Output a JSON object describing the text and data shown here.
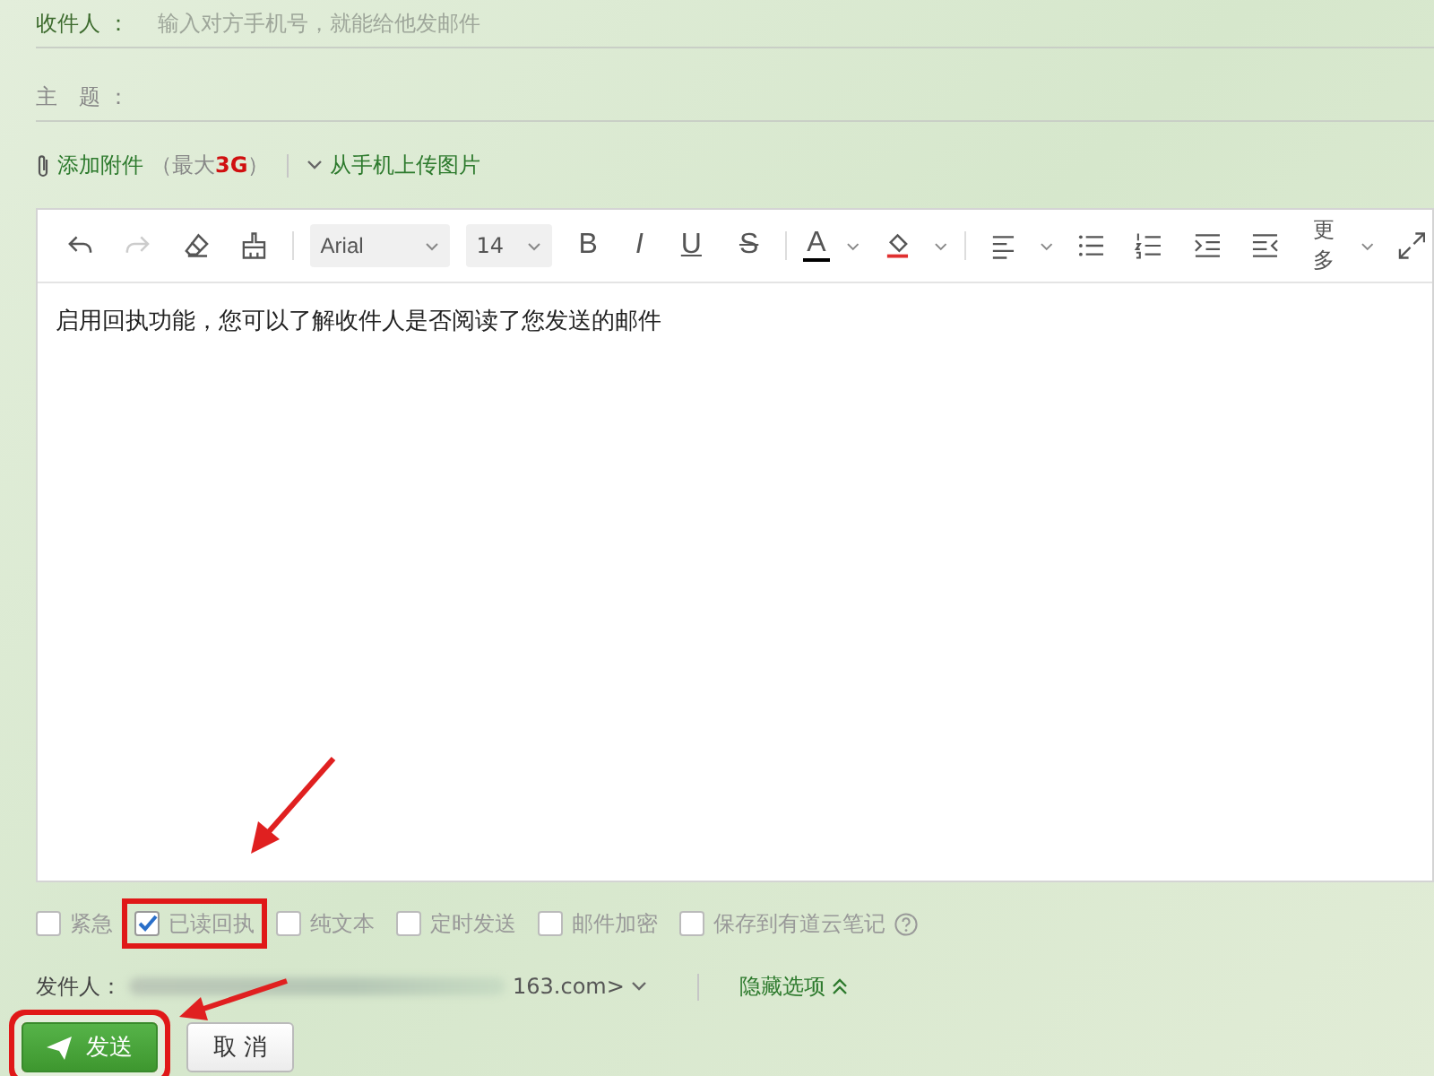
{
  "recipient": {
    "label": "收件人 ：",
    "placeholder": "输入对方手机号，就能给他发邮件"
  },
  "subject": {
    "label": "主　题 ："
  },
  "attachment": {
    "link": "添加附件",
    "note_before": "（最大",
    "size": "3G",
    "note_after": "）",
    "phone_upload": "从手机上传图片"
  },
  "toolbar": {
    "font": "Arial",
    "size": "14",
    "bold": "B",
    "italic": "I",
    "underline": "U",
    "strike": "S",
    "font_color": "A",
    "more": "更多",
    "redo_disabled": true
  },
  "body": "启用回执功能，您可以了解收件人是否阅读了您发送的邮件",
  "options": [
    {
      "label": "紧急",
      "checked": false,
      "highlighted": false
    },
    {
      "label": "已读回执",
      "checked": true,
      "highlighted": true
    },
    {
      "label": "纯文本",
      "checked": false,
      "highlighted": false
    },
    {
      "label": "定时发送",
      "checked": false,
      "highlighted": false
    },
    {
      "label": "邮件加密",
      "checked": false,
      "highlighted": false
    },
    {
      "label": "保存到有道云笔记",
      "checked": false,
      "highlighted": false,
      "help": true
    }
  ],
  "sender": {
    "label": "发件人：",
    "address_visible": "163.com>",
    "hide_options": "隐藏选项"
  },
  "buttons": [
    {
      "label": "发送",
      "kind": "primary",
      "highlighted": true
    },
    {
      "label": "取 消",
      "kind": "secondary",
      "highlighted": false
    }
  ]
}
